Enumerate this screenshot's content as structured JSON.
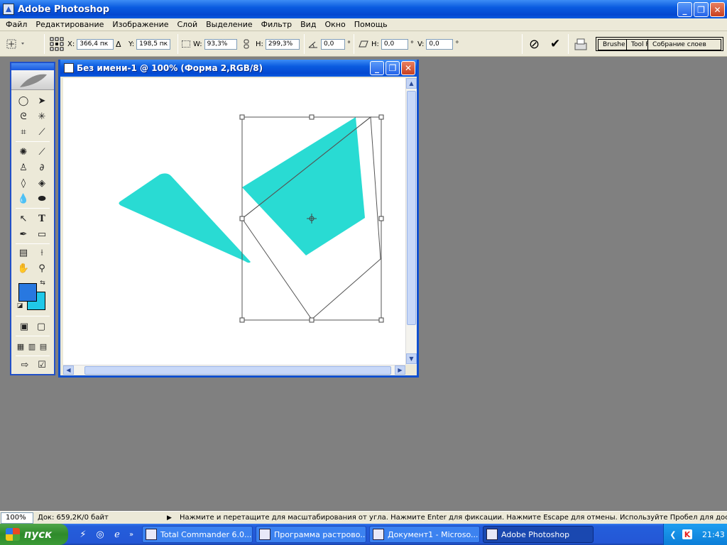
{
  "app": {
    "title": "Adobe Photoshop"
  },
  "window_controls": {
    "minimize": "_",
    "maximize": "❐",
    "close": "✕"
  },
  "menu": [
    "Файл",
    "Редактирование",
    "Изображение",
    "Слой",
    "Выделение",
    "Фильтр",
    "Вид",
    "Окно",
    "Помощь"
  ],
  "options": {
    "x_label": "X:",
    "x_value": "366,4 пк",
    "delta_label": "Δ",
    "y_label": "Y:",
    "y_value": "198,5 пк",
    "w_label": "W:",
    "w_value": "93,3%",
    "h_label": "H:",
    "h_value": "299,3%",
    "angle_value": "0,0",
    "angle_unit": "°",
    "skew_h_label": "H:",
    "skew_h_value": "0,0",
    "skew_h_unit": "°",
    "skew_v_label": "V:",
    "skew_v_value": "0,0",
    "skew_v_unit": "°",
    "cancel_glyph": "⊘",
    "commit_glyph": "✔"
  },
  "palette_well": {
    "tabs": [
      "Brushe",
      "Tool P",
      "Собрание слоев"
    ]
  },
  "colors": {
    "foreground": "#2878e0",
    "background": "#20c8e8",
    "shape": "#29dbd3",
    "canvas": "#ffffff",
    "workspace": "#808080"
  },
  "document": {
    "title": "Без имени-1 @ 100% (Форма 2,RGB/8)"
  },
  "status": {
    "zoom": "100%",
    "doc_info": "Док: 659,2К/0 байт",
    "arrow": "▶",
    "hint": "Нажмите и перетащите для масштабирования от угла. Нажмите Enter для фиксации. Нажмите Escape для отмены. Используйте Пробел для доступа к инстру"
  },
  "taskbar": {
    "start_label": "пуск",
    "more": "»",
    "tasks": [
      {
        "label": "Total Commander 6.0...",
        "active": false
      },
      {
        "label": "Программа растрово...",
        "active": false
      },
      {
        "label": "Документ1 - Microso...",
        "active": false
      },
      {
        "label": "Adobe Photoshop",
        "active": true
      }
    ],
    "clock": "21:43",
    "tray_back": "❮",
    "tray_k": "K"
  }
}
